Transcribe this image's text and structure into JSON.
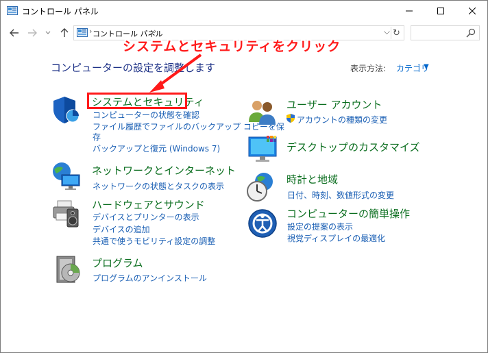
{
  "window": {
    "title": "コントロール パネル",
    "min_glyph": "—",
    "max_glyph": "☐",
    "close_glyph": "✕"
  },
  "nav": {
    "back_icon": "arrow-left-icon",
    "forward_icon": "arrow-right-icon",
    "recent_icon": "chevron-down-icon",
    "up_icon": "arrow-up-icon",
    "address_crumb": "コントロール パネル",
    "crumb_sep": "›",
    "dropdown_glyph": "⌵",
    "refresh_glyph": "↻",
    "search_placeholder": ""
  },
  "content": {
    "heading": "コンピューターの設定を調整します",
    "view_by_label": "表示方法:",
    "view_by_value": "カテゴリ",
    "view_by_arrow": "▼"
  },
  "categories": {
    "system": {
      "title": "システムとセキュリティ",
      "links": [
        "コンピューターの状態を確認",
        "ファイル履歴でファイルのバックアップ コピーを保",
        "存",
        "バックアップと復元 (Windows 7)"
      ]
    },
    "network": {
      "title": "ネットワークとインターネット",
      "links": [
        "ネットワークの状態とタスクの表示"
      ]
    },
    "hardware": {
      "title": "ハードウェアとサウンド",
      "links": [
        "デバイスとプリンターの表示",
        "デバイスの追加",
        "共通で使うモビリティ設定の調整"
      ]
    },
    "programs": {
      "title": "プログラム",
      "links": [
        "プログラムのアンインストール"
      ]
    },
    "user": {
      "title": "ユーザー アカウント",
      "links": [
        "アカウントの種類の変更"
      ]
    },
    "desktop": {
      "title": "デスクトップのカスタマイズ",
      "links": []
    },
    "clock": {
      "title": "時計と地域",
      "links": [
        "日付、時刻、数値形式の変更"
      ]
    },
    "ease": {
      "title": "コンピューターの簡単操作",
      "links": [
        "設定の提案の表示",
        "視覚ディスプレイの最適化"
      ]
    }
  },
  "annotation": {
    "text": "システムとセキュリティをクリック",
    "color": "#ff1a1a"
  },
  "colors": {
    "category_title": "#0b6e1f",
    "link": "#1a5fb4",
    "heading": "#1e3287"
  }
}
